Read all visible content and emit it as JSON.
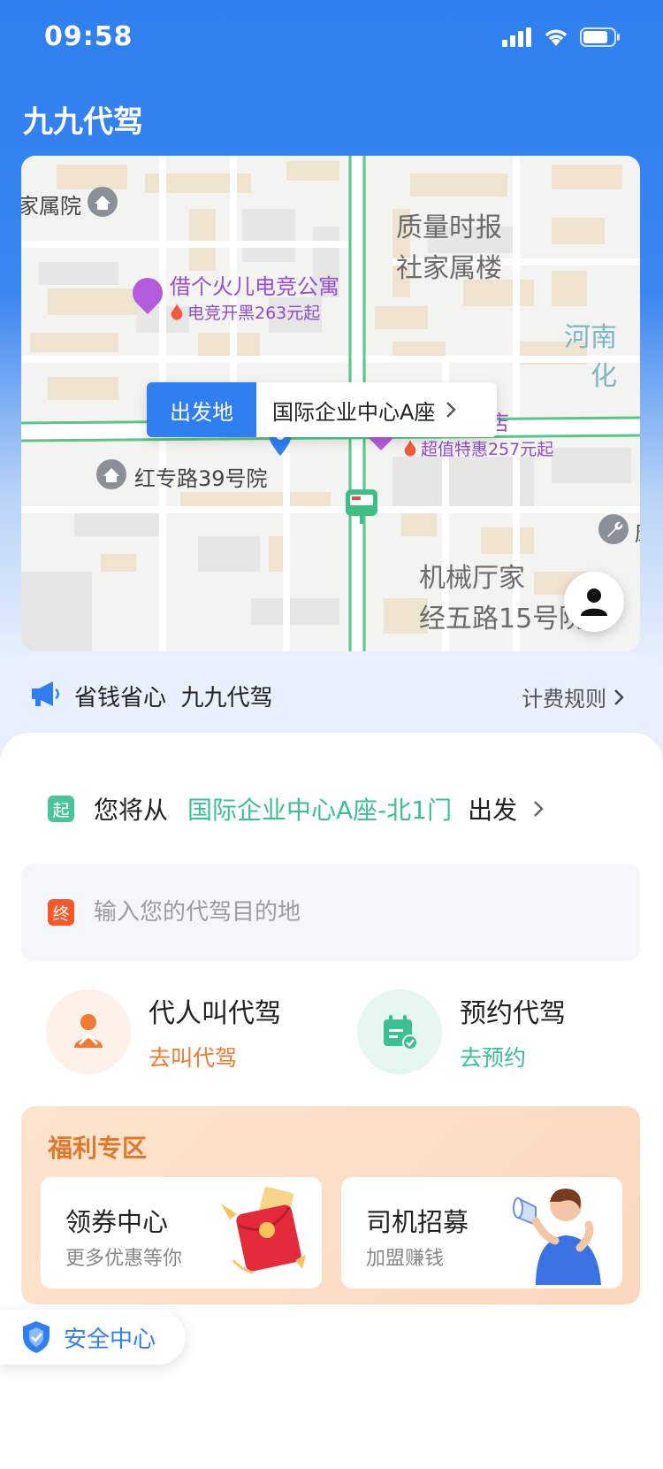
{
  "status_bar": {
    "time": "09:58"
  },
  "app": {
    "title": "九九代驾"
  },
  "map": {
    "pois": [
      {
        "name": "家属院"
      },
      {
        "name": "质量时报"
      },
      {
        "name": "社家属楼"
      },
      {
        "name": "借个火儿电竞公寓",
        "promo": "电竞开黑263元起"
      },
      {
        "name": "河南"
      },
      {
        "name": "化"
      },
      {
        "name": "维也纳酒店",
        "promo": "超值特惠257元起"
      },
      {
        "name": "红专路39号院"
      },
      {
        "name": "机械厅家"
      },
      {
        "name": "经五路15号院"
      },
      {
        "name": "康"
      }
    ],
    "start_tag": "出发地",
    "start_name": "国际企业中心A座"
  },
  "notice": {
    "text": "省钱省心  九九代驾",
    "link": "计费规则"
  },
  "trip": {
    "start_badge": "起",
    "from_prefix": "您将从",
    "from_place": "国际企业中心A座-北1门",
    "from_suffix": "出发",
    "end_badge": "终",
    "dest_placeholder": "输入您的代驾目的地"
  },
  "actions": [
    {
      "title": "代人叫代驾",
      "sub": "去叫代驾",
      "sub_color": "#f07a30"
    },
    {
      "title": "预约代驾",
      "sub": "去预约",
      "sub_color": "#3bbf93"
    }
  ],
  "welfare": {
    "title": "福利专区",
    "cards": [
      {
        "title": "领券中心",
        "sub": "更多优惠等你"
      },
      {
        "title": "司机招募",
        "sub": "加盟赚钱"
      }
    ]
  },
  "safety": {
    "label": "安全中心"
  },
  "colors": {
    "primary": "#2f7ff0",
    "green": "#3bbf93",
    "orange": "#f07a30",
    "end_red": "#f5582b"
  }
}
